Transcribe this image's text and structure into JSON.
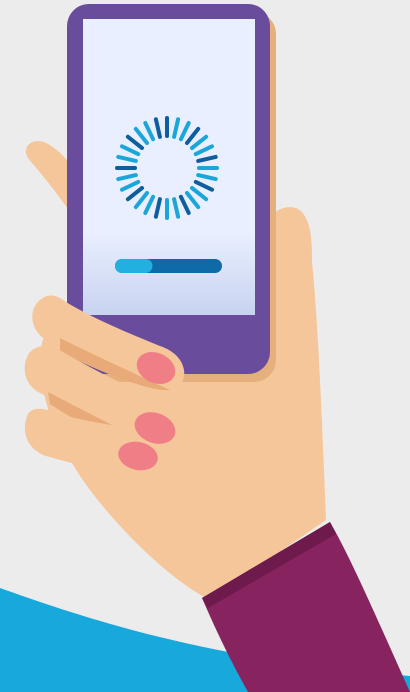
{
  "scene": {
    "subject": "hand-holding-phone-with-loading-screen"
  },
  "colors": {
    "background": "#ececec",
    "wave": "#17a8dc",
    "skin": "#f5c69a",
    "skin_shadow": "#e8aa78",
    "nail": "#f07e86",
    "sleeve": "#87235f",
    "sleeve_shadow": "#6e1a4c",
    "phone_body": "#6a4c9c",
    "phone_shadow": "#e6b07c",
    "screen_top": "#e9efff",
    "screen_bottom": "#c8d3ef",
    "spinner_light": "#1aa6d9",
    "spinner_dark": "#0d5e9c",
    "progress_track": "#0f6ba8",
    "progress_fill": "#22b0e0"
  },
  "loading": {
    "spinner_icon": "loading-spinner-icon",
    "progress": 0.35
  }
}
